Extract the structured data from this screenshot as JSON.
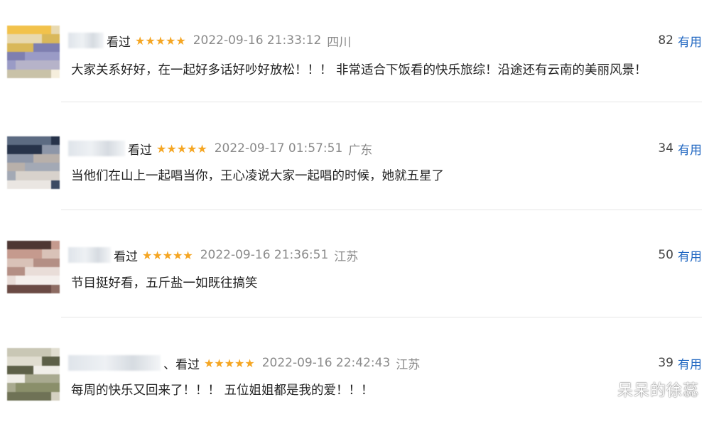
{
  "reviews": [
    {
      "watched": "看过",
      "stars": "★★★★★",
      "time": "2022-09-16 21:33:12",
      "location": "四川",
      "useful_count": "82",
      "useful_label": "有用",
      "text": "大家关系好好，在一起好多话好吵好放松！！！ 非常适合下饭看的快乐旅综！沿途还有云南的美丽风景！"
    },
    {
      "watched": "看过",
      "stars": "★★★★★",
      "time": "2022-09-17 01:57:51",
      "location": "广东",
      "useful_count": "34",
      "useful_label": "有用",
      "text": "当他们在山上一起唱当你，王心凌说大家一起唱的时候，她就五星了"
    },
    {
      "watched": "看过",
      "stars": "★★★★★",
      "time": "2022-09-16 21:36:51",
      "location": "江苏",
      "useful_count": "50",
      "useful_label": "有用",
      "text": "节目挺好看，五斤盐一如既往搞笑"
    },
    {
      "watched": "、看过",
      "stars": "★★★★★",
      "time": "2022-09-16 22:42:43",
      "location": "江苏",
      "useful_count": "39",
      "useful_label": "有用",
      "text": "每周的快乐又回来了！！！ 五位姐姐都是我的爱！！！"
    }
  ],
  "watermark": "呆呆的徐蕊",
  "colors": {
    "star": "#f5a623",
    "link": "#1f66c1",
    "meta": "#8a8a8a"
  }
}
